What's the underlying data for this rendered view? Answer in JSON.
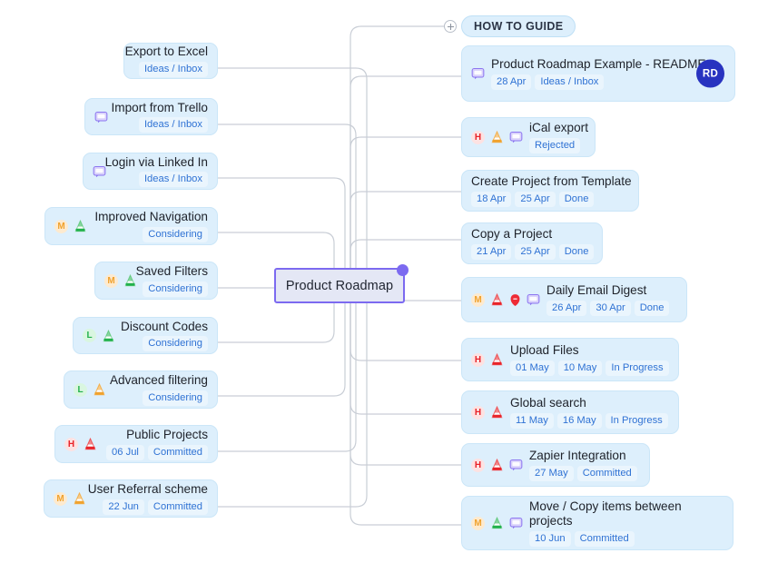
{
  "root": {
    "label": "Product Roadmap",
    "handle_icon": "drag-handle-dot"
  },
  "guide": {
    "label": "HOW TO GUIDE",
    "add_icon": "plus-circle-icon"
  },
  "legend": {
    "priority_high": "H",
    "priority_medium": "M",
    "priority_low": "L",
    "icon_effort": "pyramid-icon",
    "icon_comment": "comment-bubble-icon",
    "icon_blocker": "blocker-icon"
  },
  "colors": {
    "card_bg": "#ddeffc",
    "card_border": "#cbe6f8",
    "tag_bg": "#eaf5fd",
    "tag_text": "#2f72d4",
    "root_border": "#7c6af0",
    "root_bg": "#e4e7f5",
    "handle": "#7c6af0",
    "avatar_bg": "#2833c0",
    "high": "#e8242a",
    "medium": "#f0a22e",
    "low": "#22b14c",
    "wire": "#c9ced6"
  },
  "left_cards": [
    {
      "title": "Export to Excel",
      "tags": [
        "Ideas / Inbox"
      ],
      "icons": []
    },
    {
      "title": "Import from Trello",
      "tags": [
        "Ideas / Inbox"
      ],
      "icons": [
        "comment"
      ]
    },
    {
      "title": "Login via Linked In",
      "tags": [
        "Ideas / Inbox"
      ],
      "icons": [
        "comment"
      ]
    },
    {
      "title": "Improved Navigation",
      "tags": [
        "Considering"
      ],
      "icons": [
        "pri-M",
        "pyr-low"
      ]
    },
    {
      "title": "Saved Filters",
      "tags": [
        "Considering"
      ],
      "icons": [
        "pri-M",
        "pyr-low"
      ]
    },
    {
      "title": "Discount Codes",
      "tags": [
        "Considering"
      ],
      "icons": [
        "pri-L",
        "pyr-low"
      ]
    },
    {
      "title": "Advanced filtering",
      "tags": [
        "Considering"
      ],
      "icons": [
        "pri-L",
        "pyr-med"
      ]
    },
    {
      "title": "Public Projects",
      "tags": [
        "06 Jul",
        "Committed"
      ],
      "icons": [
        "pri-H",
        "pyr-high"
      ]
    },
    {
      "title": "User Referral scheme",
      "tags": [
        "22 Jun",
        "Committed"
      ],
      "icons": [
        "pri-M",
        "pyr-med"
      ]
    }
  ],
  "right_cards": [
    {
      "title": "Product Roadmap Example - README",
      "tags": [
        "28 Apr",
        "Ideas / Inbox"
      ],
      "icons": [
        "comment"
      ],
      "avatar": "RD"
    },
    {
      "title": "iCal export",
      "tags": [
        "Rejected"
      ],
      "icons": [
        "pri-H",
        "pyr-med",
        "comment"
      ]
    },
    {
      "title": "Create Project from Template",
      "tags": [
        "18 Apr",
        "25 Apr",
        "Done"
      ],
      "icons": []
    },
    {
      "title": "Copy a Project",
      "tags": [
        "21 Apr",
        "25 Apr",
        "Done"
      ],
      "icons": []
    },
    {
      "title": "Daily Email Digest",
      "tags": [
        "26 Apr",
        "30 Apr",
        "Done"
      ],
      "icons": [
        "pri-M",
        "pyr-high",
        "blocker",
        "comment"
      ]
    },
    {
      "title": "Upload Files",
      "tags": [
        "01 May",
        "10 May",
        "In Progress"
      ],
      "icons": [
        "pri-H",
        "pyr-high"
      ]
    },
    {
      "title": "Global search",
      "tags": [
        "11 May",
        "16 May",
        "In Progress"
      ],
      "icons": [
        "pri-H",
        "pyr-high"
      ]
    },
    {
      "title": "Zapier Integration",
      "tags": [
        "27 May",
        "Committed"
      ],
      "icons": [
        "pri-H",
        "pyr-high",
        "comment"
      ]
    },
    {
      "title": "Move / Copy items between projects",
      "tags": [
        "10 Jun",
        "Committed"
      ],
      "icons": [
        "pri-M",
        "pyr-low",
        "comment"
      ]
    }
  ]
}
